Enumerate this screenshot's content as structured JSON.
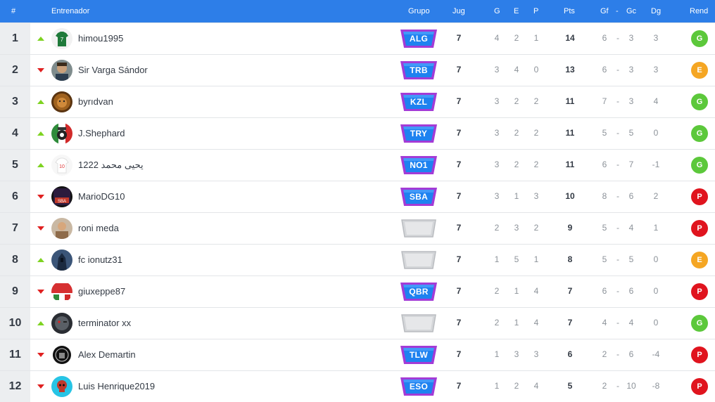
{
  "header": {
    "rank": "#",
    "coach": "Entrenador",
    "group": "Grupo",
    "played": "Jug",
    "won": "G",
    "drawn": "E",
    "lost": "P",
    "points": "Pts",
    "goals_for": "Gf",
    "dash": "-",
    "goals_against": "Gc",
    "goal_diff": "Dg",
    "performance": "Rend"
  },
  "colors": {
    "header_bg": "#2d7ee8",
    "trend_up": "#7ed321",
    "trend_down": "#e02020",
    "badge_purple": "#a33bd6",
    "badge_blue": "#1e82f0",
    "rend_G": "#5cc83b",
    "rend_E": "#f5a623",
    "rend_P": "#e0141e"
  },
  "rows": [
    {
      "rank": "1",
      "trend": "up",
      "trend_icon": "triangle-up-icon",
      "avatar": "green-jersey-7",
      "name": "himou1995",
      "group": "ALG",
      "played": "7",
      "won": "4",
      "drawn": "2",
      "lost": "1",
      "points": "14",
      "gf": "6",
      "gc": "3",
      "dg": "3",
      "rend": "G"
    },
    {
      "rank": "2",
      "trend": "down",
      "trend_icon": "triangle-down-icon",
      "avatar": "player-photo",
      "name": "Sir Varga Sándor",
      "group": "TRB",
      "played": "7",
      "won": "3",
      "drawn": "4",
      "lost": "0",
      "points": "13",
      "gf": "6",
      "gc": "3",
      "dg": "3",
      "rend": "E"
    },
    {
      "rank": "3",
      "trend": "up",
      "trend_icon": "triangle-up-icon",
      "avatar": "lion-photo",
      "name": "byrıdvan",
      "group": "KZL",
      "played": "7",
      "won": "3",
      "drawn": "2",
      "lost": "2",
      "points": "11",
      "gf": "7",
      "gc": "3",
      "dg": "4",
      "rend": "G"
    },
    {
      "rank": "4",
      "trend": "up",
      "trend_icon": "triangle-up-icon",
      "avatar": "italy-ball",
      "name": "J.Shephard",
      "group": "TRY",
      "played": "7",
      "won": "3",
      "drawn": "2",
      "lost": "2",
      "points": "11",
      "gf": "5",
      "gc": "5",
      "dg": "0",
      "rend": "G"
    },
    {
      "rank": "5",
      "trend": "up",
      "trend_icon": "triangle-up-icon",
      "avatar": "white-jersey-10",
      "name": "يحيى محمد 1222",
      "group": "NO1",
      "played": "7",
      "won": "3",
      "drawn": "2",
      "lost": "2",
      "points": "11",
      "gf": "6",
      "gc": "7",
      "dg": "-1",
      "rend": "G"
    },
    {
      "rank": "6",
      "trend": "down",
      "trend_icon": "triangle-down-icon",
      "avatar": "sba-logo",
      "name": "MarioDG10",
      "group": "SBA",
      "played": "7",
      "won": "3",
      "drawn": "1",
      "lost": "3",
      "points": "10",
      "gf": "8",
      "gc": "6",
      "dg": "2",
      "rend": "P"
    },
    {
      "rank": "7",
      "trend": "down",
      "trend_icon": "triangle-down-icon",
      "avatar": "person-photo",
      "name": "roni meda",
      "group": "",
      "played": "7",
      "won": "2",
      "drawn": "3",
      "lost": "2",
      "points": "9",
      "gf": "5",
      "gc": "4",
      "dg": "1",
      "rend": "P"
    },
    {
      "rank": "8",
      "trend": "up",
      "trend_icon": "triangle-up-icon",
      "avatar": "dark-hood",
      "name": "fc ionutz31",
      "group": "",
      "played": "7",
      "won": "1",
      "drawn": "5",
      "lost": "1",
      "points": "8",
      "gf": "5",
      "gc": "5",
      "dg": "0",
      "rend": "E"
    },
    {
      "rank": "9",
      "trend": "down",
      "trend_icon": "triangle-down-icon",
      "avatar": "red-banner",
      "name": "giuxeppe87",
      "group": "QBR",
      "played": "7",
      "won": "2",
      "drawn": "1",
      "lost": "4",
      "points": "7",
      "gf": "6",
      "gc": "6",
      "dg": "0",
      "rend": "P"
    },
    {
      "rank": "10",
      "trend": "up",
      "trend_icon": "triangle-up-icon",
      "avatar": "terminator-face",
      "name": "terminator xx",
      "group": "",
      "played": "7",
      "won": "2",
      "drawn": "1",
      "lost": "4",
      "points": "7",
      "gf": "4",
      "gc": "4",
      "dg": "0",
      "rend": "G"
    },
    {
      "rank": "11",
      "trend": "down",
      "trend_icon": "triangle-down-icon",
      "avatar": "black-crest",
      "name": "Alex Demartin",
      "group": "TLW",
      "played": "7",
      "won": "1",
      "drawn": "3",
      "lost": "3",
      "points": "6",
      "gf": "2",
      "gc": "6",
      "dg": "-4",
      "rend": "P"
    },
    {
      "rank": "12",
      "trend": "down",
      "trend_icon": "triangle-down-icon",
      "avatar": "red-skull",
      "name": "Luis Henrique2019",
      "group": "ESO",
      "played": "7",
      "won": "1",
      "drawn": "2",
      "lost": "4",
      "points": "5",
      "gf": "2",
      "gc": "10",
      "dg": "-8",
      "rend": "P"
    }
  ]
}
